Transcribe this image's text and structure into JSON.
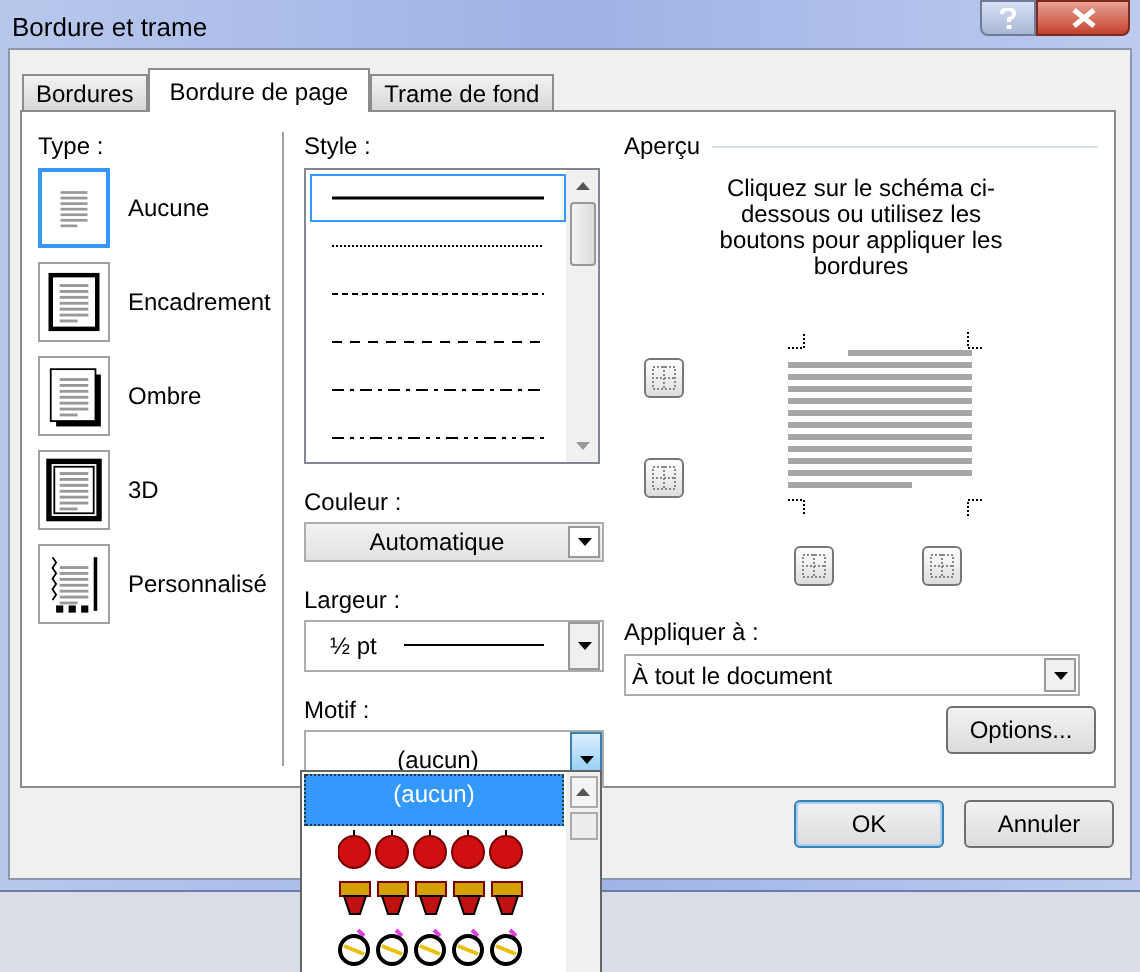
{
  "window": {
    "title": "Bordure et trame"
  },
  "tabs": [
    {
      "label": "Bordures",
      "selected": false
    },
    {
      "label": "Bordure de page",
      "selected": true
    },
    {
      "label": "Trame de fond",
      "selected": false
    }
  ],
  "type": {
    "label": "Type :",
    "options": [
      {
        "label": "Aucune",
        "kind": "none",
        "selected": true
      },
      {
        "label": "Encadrement",
        "kind": "box",
        "selected": false
      },
      {
        "label": "Ombre",
        "kind": "shadow",
        "selected": false
      },
      {
        "label": "3D",
        "kind": "relief",
        "selected": false
      },
      {
        "label": "Personnalisé",
        "kind": "custom",
        "selected": false
      }
    ]
  },
  "style": {
    "label": "Style :",
    "lines": [
      {
        "kind": "solid",
        "selected": true
      },
      {
        "kind": "dotted",
        "selected": false
      },
      {
        "kind": "dashed",
        "selected": false
      },
      {
        "kind": "long-dashed",
        "selected": false
      },
      {
        "kind": "dash-dot",
        "selected": false
      },
      {
        "kind": "dash-dot-dot",
        "selected": false
      }
    ]
  },
  "color": {
    "label": "Couleur :",
    "value": "Automatique"
  },
  "width": {
    "label": "Largeur :",
    "value": "½ pt"
  },
  "art": {
    "label": "Motif :",
    "value": "(aucun)",
    "expanded": true,
    "options": [
      {
        "kind": "none",
        "label": "(aucun)",
        "selected": true
      },
      {
        "kind": "apples",
        "selected": false
      },
      {
        "kind": "cakes",
        "selected": false
      },
      {
        "kind": "balloons",
        "selected": false
      }
    ]
  },
  "preview": {
    "title": "Aperçu",
    "hint": "Cliquez sur le schéma ci-dessous ou utilisez les boutons pour appliquer les bordures"
  },
  "apply_to": {
    "label": "Appliquer à :",
    "value": "À tout le document"
  },
  "options_button": "Options...",
  "footer_buttons": [
    {
      "label": "OK",
      "default": true
    },
    {
      "label": "Annuler",
      "default": false
    }
  ]
}
